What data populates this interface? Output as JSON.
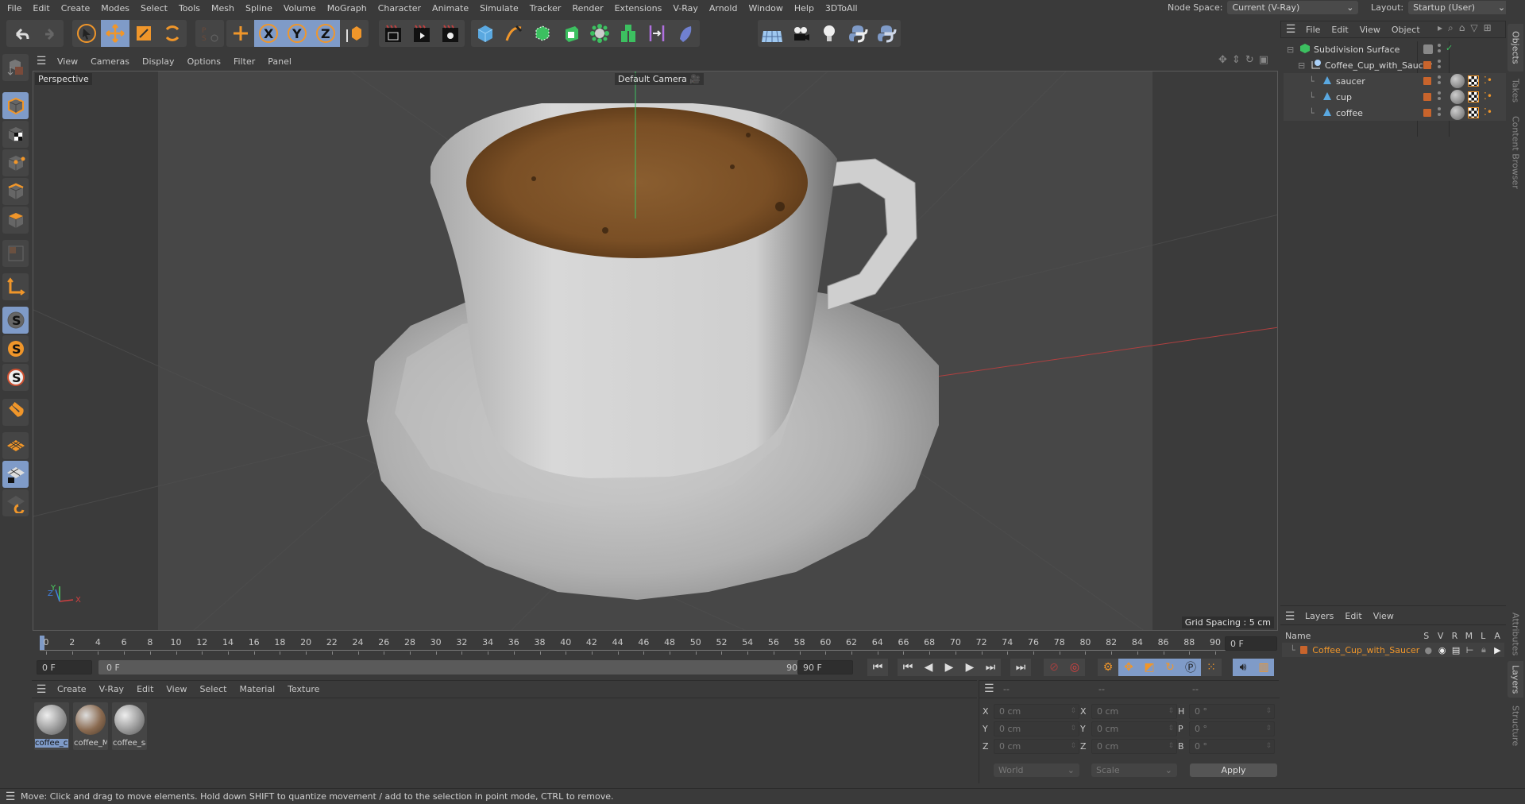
{
  "menubar": {
    "items": [
      "File",
      "Edit",
      "Create",
      "Modes",
      "Select",
      "Tools",
      "Mesh",
      "Spline",
      "Volume",
      "MoGraph",
      "Character",
      "Animate",
      "Simulate",
      "Tracker",
      "Render",
      "Extensions",
      "V-Ray",
      "Arnold",
      "Window",
      "Help",
      "3DToAll"
    ],
    "node_space_label": "Node Space:",
    "node_space_value": "Current (V-Ray)",
    "layout_label": "Layout:",
    "layout_value": "Startup (User)"
  },
  "toolbar": {
    "groups": [
      [
        "undo-icon",
        "redo-icon"
      ],
      [
        "select-cursor-icon",
        "move-icon",
        "scale-icon",
        "rotate-icon"
      ],
      [
        "ps-recent-icon"
      ],
      [
        "move-axis-icon"
      ],
      [
        "x-axis-lock-icon",
        "y-axis-lock-icon",
        "z-axis-lock-icon",
        "coordinate-system-icon"
      ],
      [
        "render-view-icon",
        "render-picture-viewer-icon",
        "render-settings-icon"
      ],
      [
        "cube-icon",
        "pen-spline-icon",
        "subdivision-icon",
        "extrude-icon",
        "mograph-cloner-icon",
        "array-cubes-icon",
        "deformer-bend-icon",
        "field-icon"
      ],
      [
        "floor-grid-icon",
        "camera-icon",
        "light-bulb-icon",
        "python-icon",
        "python-script-icon"
      ]
    ],
    "active": [
      "move-icon",
      "x-axis-lock-icon",
      "y-axis-lock-icon",
      "z-axis-lock-icon"
    ]
  },
  "left_tools": [
    "make-editable-icon",
    "model-mode-icon",
    "texture-mode-icon",
    "point-mode-icon",
    "edge-mode-icon",
    "polygon-mode-icon",
    "uv-mode-icon",
    "axis-mode-icon",
    "snap-icon",
    "snap-settings-icon",
    "snap-workplane-icon",
    "magnet-icon",
    "workplane-icon",
    "locked-workplane-icon",
    "workplane-align-icon"
  ],
  "viewport": {
    "menu": [
      "View",
      "Cameras",
      "Display",
      "Options",
      "Filter",
      "Panel"
    ],
    "view_name": "Perspective",
    "camera_label": "Default Camera",
    "grid_spacing": "Grid Spacing : 5 cm",
    "axis_labels": {
      "x": "X",
      "y": "Y",
      "z": "Z"
    },
    "nav_icons": [
      "pan-icon",
      "dolly-icon",
      "orbit-icon",
      "maximize-view-icon"
    ]
  },
  "timeline": {
    "ticks": [
      0,
      2,
      4,
      6,
      8,
      10,
      12,
      14,
      16,
      18,
      20,
      22,
      24,
      26,
      28,
      30,
      32,
      34,
      36,
      38,
      40,
      42,
      44,
      46,
      48,
      50,
      52,
      54,
      56,
      58,
      60,
      62,
      64,
      66,
      68,
      70,
      72,
      74,
      76,
      78,
      80,
      82,
      84,
      86,
      88,
      90
    ],
    "current_frame": "0 F",
    "start_field": "0 F",
    "range_start": "0 F",
    "range_end": "90 F",
    "end_field": "90 F"
  },
  "transport": [
    "go-to-start-icon",
    "prev-key-icon",
    "prev-frame-icon",
    "play-icon",
    "next-frame-icon",
    "next-key-icon",
    "go-to-end-icon",
    "record-disabled-icon",
    "autokey-icon",
    "keyframe-selection-icon",
    "key-position-icon",
    "key-scale-icon",
    "key-rotation-icon",
    "key-param-icon",
    "key-pla-icon",
    "sound-icon",
    "timeline-window-icon"
  ],
  "materials": {
    "menu": [
      "Create",
      "V-Ray",
      "Edit",
      "View",
      "Select",
      "Material",
      "Texture"
    ],
    "items": [
      {
        "name": "coffee_c",
        "selected": true
      },
      {
        "name": "coffee_M",
        "selected": false
      },
      {
        "name": "coffee_sa",
        "selected": false
      }
    ]
  },
  "coords": {
    "headers": [
      "--",
      "--",
      "--"
    ],
    "position": [
      {
        "axis": "X",
        "value": "0 cm"
      },
      {
        "axis": "Y",
        "value": "0 cm"
      },
      {
        "axis": "Z",
        "value": "0 cm"
      }
    ],
    "size": [
      {
        "axis": "X",
        "value": "0 cm"
      },
      {
        "axis": "Y",
        "value": "0 cm"
      },
      {
        "axis": "Z",
        "value": "0 cm"
      }
    ],
    "rotation": [
      {
        "axis": "H",
        "value": "0 °"
      },
      {
        "axis": "P",
        "value": "0 °"
      },
      {
        "axis": "B",
        "value": "0 °"
      }
    ],
    "space": "World",
    "mode": "Scale",
    "apply": "Apply"
  },
  "objects": {
    "menu": [
      "File",
      "Edit",
      "View",
      "Object"
    ],
    "tree": [
      {
        "name": "Subdivision Surface",
        "depth": 0,
        "type": "subdivision"
      },
      {
        "name": "Coffee_Cup_with_Saucer",
        "depth": 1,
        "type": "null"
      },
      {
        "name": "saucer",
        "depth": 2,
        "type": "polygon"
      },
      {
        "name": "cup",
        "depth": 2,
        "type": "polygon"
      },
      {
        "name": "coffee",
        "depth": 2,
        "type": "polygon"
      }
    ]
  },
  "layers": {
    "menu": [
      "Layers",
      "Edit",
      "View"
    ],
    "columns": [
      "Name",
      "S",
      "V",
      "R",
      "M",
      "L",
      "A"
    ],
    "rows": [
      {
        "name": "Coffee_Cup_with_Saucer",
        "color": "#c8642c"
      }
    ]
  },
  "side_tabs_top": [
    "Objects",
    "Takes",
    "Content Browser"
  ],
  "side_tabs_bottom": [
    "Attributes",
    "Layers",
    "Structure"
  ],
  "status": "Move: Click and drag to move elements. Hold down SHIFT to quantize movement / add to the selection in point mode, CTRL to remove.",
  "colors": {
    "accent": "#f0962a",
    "active": "#7f9bc8",
    "layer": "#c8642c"
  }
}
